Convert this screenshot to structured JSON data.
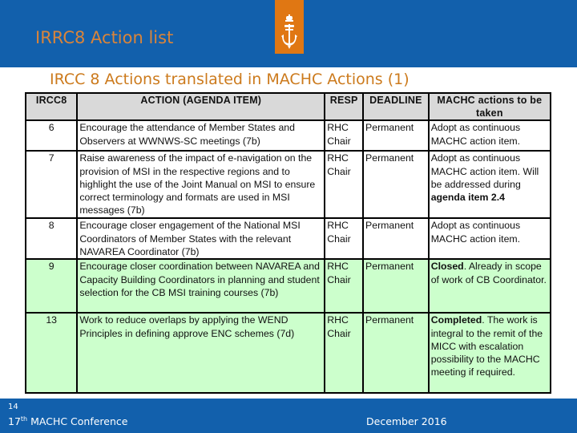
{
  "header": {
    "title": "IRRC8 Action list",
    "logo_icon": "crown-anchor-emblem-icon",
    "accent_color": "#e07713",
    "bar_color": "#1260ac"
  },
  "subtitle": "IRCC 8 Actions translated in MACHC Actions (1)",
  "table": {
    "headers": {
      "num": "IRCC8",
      "action": "ACTION (AGENDA ITEM)",
      "resp": "RESP",
      "deadline": "DEADLINE",
      "machc": "MACHC actions to be taken"
    },
    "rows": [
      {
        "num": "6",
        "action": "Encourage the attendance of Member States and Observers at WWNWS-SC meetings (7b)",
        "resp": "RHC Chair",
        "deadline": "Permanent",
        "machc_bold": "",
        "machc_text": "Adopt as continuous MACHC action item.",
        "status": "open"
      },
      {
        "num": "7",
        "action": "Raise awareness of the impact of e-navigation on the provision of MSI in the respective regions and to highlight the use of the Joint Manual on MSI to ensure correct terminology and formats are used in MSI messages (7b)",
        "resp": "RHC Chair",
        "deadline": "Permanent",
        "machc_text": "Adopt as continuous MACHC action item. Will be addressed during ",
        "machc_bold_tail": "agenda item 2.4",
        "status": "open"
      },
      {
        "num": "8",
        "action": "Encourage closer engagement of the National MSI Coordinators of Member States with the relevant NAVAREA Coordinator (7b)",
        "resp": "RHC Chair",
        "deadline": "Permanent",
        "machc_text": "Adopt as continuous MACHC action item.",
        "status": "open"
      },
      {
        "num": "9",
        "action": "Encourage closer coordination between NAVAREA and Capacity Building Coordinators in planning and student selection for the CB MSI training courses (7b)",
        "resp": "RHC Chair",
        "deadline": "Permanent",
        "machc_bold": "Closed",
        "machc_text": ". Already in scope of work of CB Coordinator.",
        "status": "closed"
      },
      {
        "num": "13",
        "action": "Work to reduce overlaps by applying the WEND Principles in defining approve ENC schemes (7d)",
        "resp": "RHC Chair",
        "deadline": "Permanent",
        "machc_bold": "Completed",
        "machc_text": ". The work is integral to the remit of the MICC with escalation possibility to the MACHC meeting if required.",
        "status": "completed"
      }
    ],
    "row_colors": {
      "open": "#ffffff",
      "closed": "#ccffcc",
      "completed": "#ccffcc"
    }
  },
  "footer": {
    "page_number": "14",
    "conference_ordinal": "17",
    "conference_suffix": "th",
    "conference_name": " MACHC Conference",
    "date": "December 2016"
  }
}
